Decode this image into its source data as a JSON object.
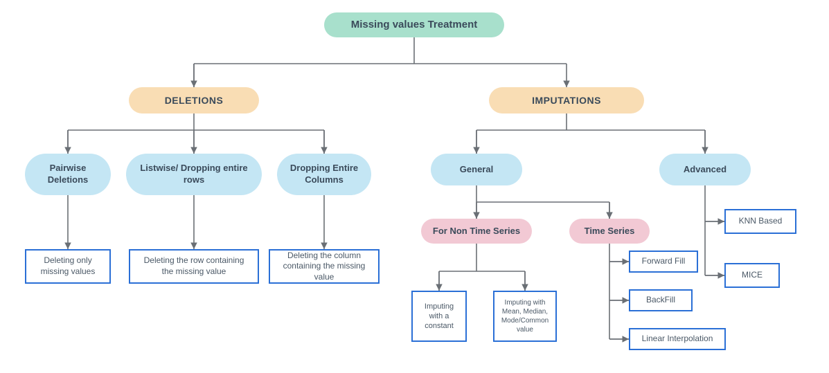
{
  "root": {
    "label": "Missing values Treatment"
  },
  "deletions": {
    "label": "DELETIONS",
    "pairwise": {
      "label": "Pairwise Deletions",
      "desc": "Deleting only missing values"
    },
    "listwise": {
      "label": "Listwise/ Dropping entire rows",
      "desc": "Deleting the row containing the missing value"
    },
    "dropcol": {
      "label": "Dropping Entire Columns",
      "desc": "Deleting the column containing the missing value"
    }
  },
  "imputations": {
    "label": "IMPUTATIONS",
    "general": {
      "label": "General",
      "nonts": {
        "label": "For Non Time Series",
        "constant": "Imputing with a constant",
        "stats": "Imputing with Mean, Median, Mode/Common value"
      },
      "ts": {
        "label": "Time Series",
        "ffill": "Forward Fill",
        "bfill": "BackFill",
        "linint": "Linear Interpolation"
      }
    },
    "advanced": {
      "label": "Advanced",
      "knn": "KNN Based",
      "mice": "MICE"
    }
  }
}
